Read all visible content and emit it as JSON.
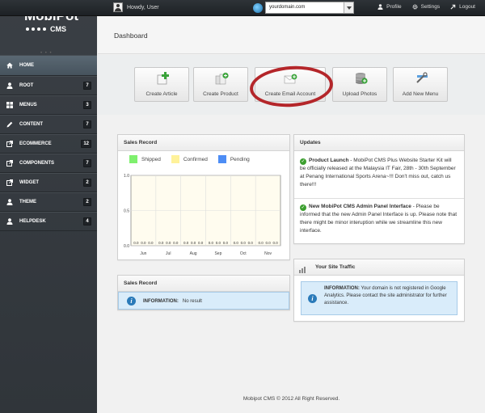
{
  "topbar": {
    "greeting": "Howdy, User",
    "domain_value": "yourdomain.com",
    "links": [
      {
        "label": "Profile",
        "icon": "user-icon"
      },
      {
        "label": "Settings",
        "icon": "gear-icon"
      },
      {
        "label": "Logout",
        "icon": "logout-arrow-icon"
      }
    ]
  },
  "logo": {
    "name": "MobiPot",
    "sub": "CMS"
  },
  "nav": [
    {
      "label": "HOME",
      "badge": "",
      "icon": "home-icon"
    },
    {
      "label": "ROOT",
      "badge": "7",
      "icon": "user-icon"
    },
    {
      "label": "MENUS",
      "badge": "3",
      "icon": "grid-icon"
    },
    {
      "label": "CONTENT",
      "badge": "7",
      "icon": "pencil-icon"
    },
    {
      "label": "ECOMMERCE",
      "badge": "12",
      "icon": "external-icon"
    },
    {
      "label": "COMPONENTS",
      "badge": "7",
      "icon": "external-icon"
    },
    {
      "label": "WIDGET",
      "badge": "2",
      "icon": "external-icon"
    },
    {
      "label": "THEME",
      "badge": "2",
      "icon": "user-icon"
    },
    {
      "label": "HELPDESK",
      "badge": "4",
      "icon": "user-icon"
    }
  ],
  "page_title": "Dashboard",
  "shortcuts": [
    {
      "label": "Create Article",
      "icon": "document-add-icon"
    },
    {
      "label": "Create Product",
      "icon": "product-add-icon"
    },
    {
      "label": "Create Email Account",
      "icon": "email-add-icon"
    },
    {
      "label": "Upload Photos",
      "icon": "database-upload-icon"
    },
    {
      "label": "Add New Menu",
      "icon": "wrench-icon"
    }
  ],
  "sales_widget": {
    "title": "Sales Record",
    "legend": [
      {
        "name": "Shipped",
        "color": "#7ff06e"
      },
      {
        "name": "Confirmed",
        "color": "#fff29a"
      },
      {
        "name": "Pending",
        "color": "#4d8df5"
      }
    ]
  },
  "chart_data": {
    "type": "bar",
    "categories": [
      "Jun",
      "Jul",
      "Aug",
      "Sep",
      "Oct",
      "Nov"
    ],
    "series": [
      {
        "name": "Shipped",
        "values": [
          0,
          0,
          0,
          0,
          0,
          0
        ]
      },
      {
        "name": "Confirmed",
        "values": [
          0,
          0,
          0,
          0,
          0,
          0
        ]
      },
      {
        "name": "Pending",
        "values": [
          0,
          0,
          0,
          0,
          0,
          0
        ]
      }
    ],
    "value_label": "0.0",
    "yticks": [
      "1.0",
      "0.5",
      "0.0"
    ],
    "ylim": [
      0,
      1
    ]
  },
  "sales_widget2": {
    "title": "Sales Record",
    "info_label": "INFORMATION:",
    "info_text": "No result"
  },
  "updates": {
    "title": "Updates",
    "items": [
      {
        "heading": "Product Launch",
        "text": " - MobiPot CMS Plus Website Starter Kit will be officially released at the Malaysia IT Fair, 28th - 30th September at Penang International Sports Arena~!!! Don't miss out, catch us there!!!"
      },
      {
        "heading": "New MobiPot CMS Admin Panel Interface",
        "text": " - Please be informed that the new Admin Panel Interface is up. Please note that there might be minor interuption while we streamline this new interface."
      }
    ]
  },
  "traffic": {
    "title": "Your Site Traffic",
    "info_label": "INFORMATION:",
    "info_text": " Your domain is not registered in Google Analytics. Please contact the site administrator for further assistance."
  },
  "footer": "Mobipot CMS © 2012 All Right Reserved."
}
